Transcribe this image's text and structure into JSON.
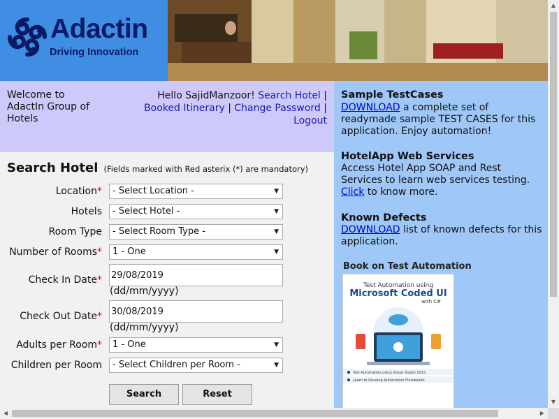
{
  "header": {
    "brand_name": "Adactin",
    "brand_tagline": "Driving Innovation"
  },
  "welcome": {
    "line1": "Welcome to",
    "line2": "AdactIn Group of",
    "line3": "Hotels",
    "greeting": "Hello SajidManzoor!",
    "links": {
      "search_hotel": "Search Hotel",
      "booked_itinerary": "Booked Itinerary",
      "change_password": "Change Password",
      "logout": "Logout"
    },
    "separator": "|"
  },
  "form": {
    "title": "Search Hotel",
    "note": "(Fields marked with Red asterix (*) are mandatory)",
    "required_marker": "*",
    "location": {
      "label": "Location",
      "value": "- Select Location -"
    },
    "hotels": {
      "label": "Hotels",
      "value": "- Select Hotel -"
    },
    "room_type": {
      "label": "Room Type",
      "value": "- Select Room Type -"
    },
    "num_rooms": {
      "label": "Number of Rooms",
      "value": "1 - One"
    },
    "check_in": {
      "label": "Check In Date",
      "value": "29/08/2019",
      "hint": "(dd/mm/yyyy)"
    },
    "check_out": {
      "label": "Check Out Date",
      "value": "30/08/2019",
      "hint": "(dd/mm/yyyy)"
    },
    "adults": {
      "label": "Adults per Room",
      "value": "1 - One"
    },
    "children": {
      "label": "Children per Room",
      "value": "- Select Children per Room -"
    },
    "search_button": "Search",
    "reset_button": "Reset"
  },
  "sidebar": {
    "testcases": {
      "title": "Sample TestCases",
      "link": "DOWNLOAD",
      "text": " a complete set of readymade sample TEST CASES for this application. Enjoy automation!"
    },
    "webservices": {
      "title": "HotelApp Web Services",
      "text": "Access Hotel App SOAP and Rest Services to learn web services testing.",
      "link": "Click",
      "text_after": " to know more."
    },
    "defects": {
      "title": "Known Defects",
      "link": "DOWNLOAD",
      "text": " list of known defects for this application."
    },
    "book": {
      "heading": "Book on Test Automation",
      "cover_top": "Test Automation using",
      "cover_title": "Microsoft Coded UI",
      "cover_sub": "with C#",
      "cover_bullet1": "Test Automation using Visual Studio 2015",
      "cover_bullet2": "Learn to Develop Automation Framework"
    }
  },
  "colors": {
    "logo_bg": "#3f8ee4",
    "welcome_bg": "#cdc9fb",
    "form_bg": "#f1f1f1",
    "sidebar_bg": "#9fc7f8",
    "link": "#0000cc",
    "required": "#ee0000"
  }
}
